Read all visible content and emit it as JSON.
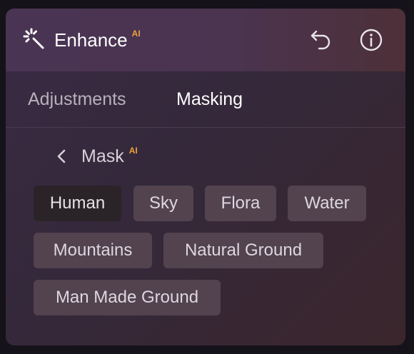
{
  "header": {
    "title": "Enhance",
    "ai_badge": "AI",
    "accent_color": "#f0a03a",
    "icons": [
      "sparkle-wand-icon",
      "undo-icon",
      "info-icon"
    ]
  },
  "tabs": [
    {
      "label": "Adjustments",
      "active": false
    },
    {
      "label": "Masking",
      "active": true
    }
  ],
  "mask": {
    "back_icon": "chevron-left-icon",
    "label": "Mask",
    "ai_badge": "AI"
  },
  "chips": [
    {
      "label": "Human",
      "selected": true
    },
    {
      "label": "Sky",
      "selected": false
    },
    {
      "label": "Flora",
      "selected": false
    },
    {
      "label": "Water",
      "selected": false
    },
    {
      "label": "Mountains",
      "selected": false
    },
    {
      "label": "Natural Ground",
      "selected": false
    },
    {
      "label": "Man Made Ground",
      "selected": false
    }
  ]
}
